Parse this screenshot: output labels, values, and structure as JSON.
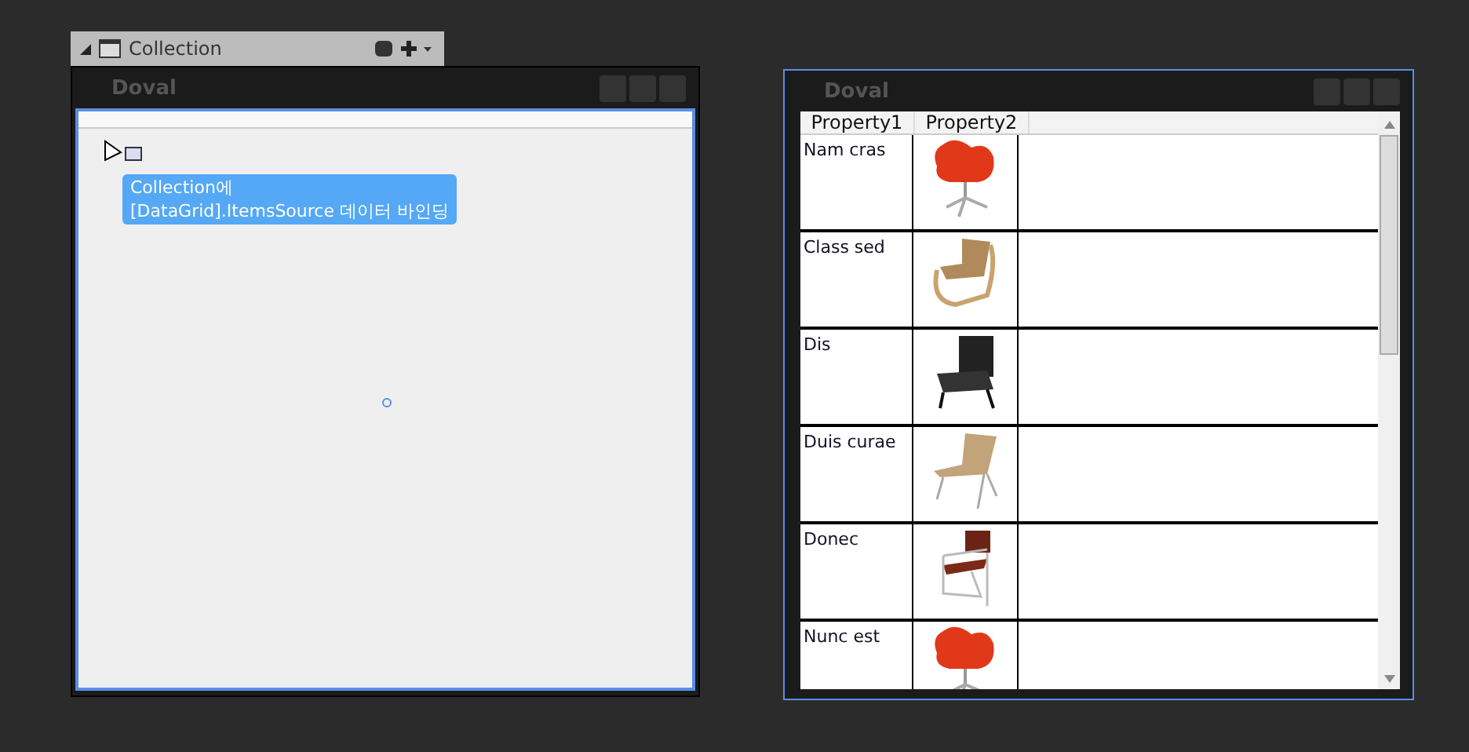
{
  "designer": {
    "tab_title": "Collection",
    "window_title": "Doval",
    "hint": "Collection에\n[DataGrid].ItemsSource 데이터 바인딩"
  },
  "preview": {
    "window_title": "Doval",
    "columns": [
      "Property1",
      "Property2"
    ],
    "rows": [
      {
        "property1": "Nam cras",
        "kind": "swan"
      },
      {
        "property1": "Class sed",
        "kind": "bent"
      },
      {
        "property1": "Dis",
        "kind": "black"
      },
      {
        "property1": "Duis curae",
        "kind": "lounge"
      },
      {
        "property1": "Donec",
        "kind": "tube"
      },
      {
        "property1": "Nunc est",
        "kind": "swan"
      }
    ]
  }
}
